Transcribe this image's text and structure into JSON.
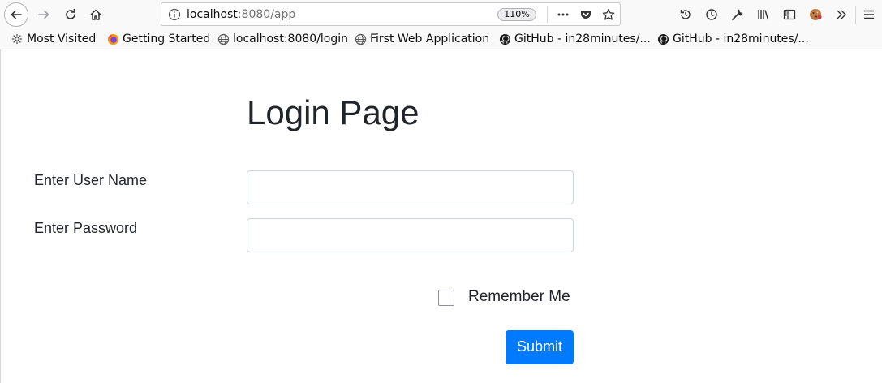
{
  "browser": {
    "url_host": "localhost",
    "url_path": ":8080/app",
    "zoom": "110%",
    "icons": {
      "back": "back-arrow-icon",
      "forward": "forward-arrow-icon",
      "reload": "reload-icon",
      "home": "home-icon",
      "info": "site-info-icon",
      "page_actions": "more-horizontal-icon",
      "pocket": "pocket-icon",
      "bookmark": "star-icon",
      "history": "history-icon",
      "recent": "clock-icon",
      "tools": "wrench-icon",
      "library": "library-icon",
      "sidebar": "sidebar-icon",
      "cookie": "cookie-icon",
      "overflow": "chevron-double-right-icon",
      "menu": "hamburger-menu-icon"
    }
  },
  "bookmarks": [
    {
      "label": "Most Visited",
      "icon": "gear-icon"
    },
    {
      "label": "Getting Started",
      "icon": "firefox-icon"
    },
    {
      "label": "localhost:8080/login",
      "icon": "globe-icon"
    },
    {
      "label": "First Web Application",
      "icon": "globe-icon"
    },
    {
      "label": "GitHub - in28minutes/...",
      "icon": "github-icon"
    },
    {
      "label": "GitHub - in28minutes/...",
      "icon": "github-icon"
    }
  ],
  "page": {
    "title": "Login Page",
    "username_label": "Enter User Name",
    "username_value": "",
    "password_label": "Enter Password",
    "password_value": "",
    "remember_label": "Remember Me",
    "remember_checked": false,
    "submit_label": "Submit"
  },
  "colors": {
    "primary": "#007bff",
    "text": "#212529",
    "input_border": "#ced4da"
  }
}
